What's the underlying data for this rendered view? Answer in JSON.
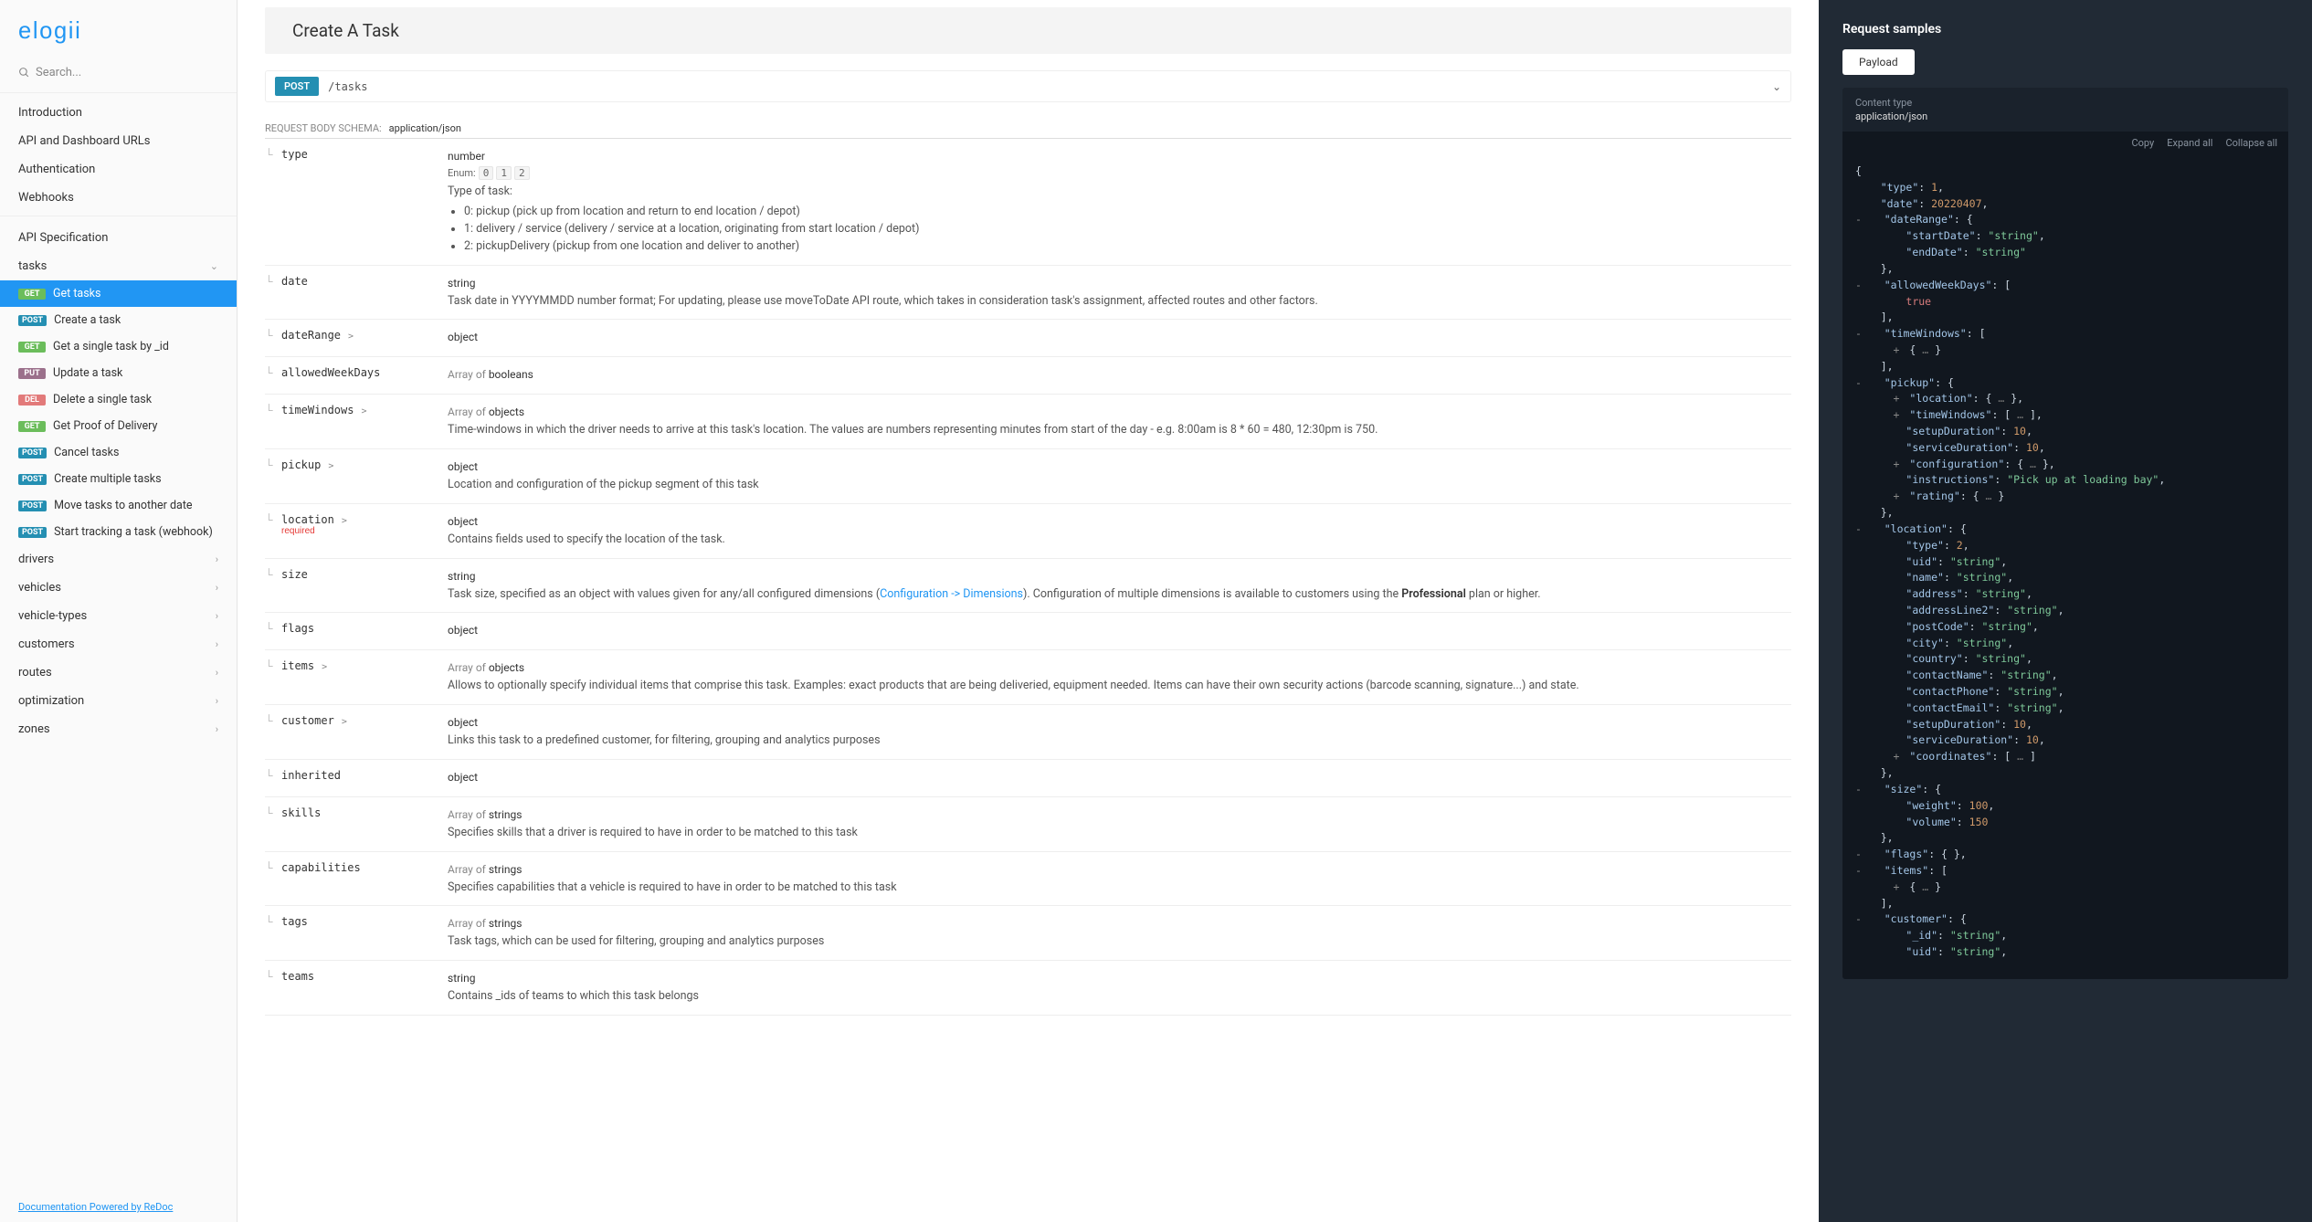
{
  "brand": "elogii",
  "search_placeholder": "Search...",
  "footer": "Documentation Powered by ReDoc",
  "nav_top": [
    "Introduction",
    "API and Dashboard URLs",
    "Authentication",
    "Webhooks"
  ],
  "nav_spec_heading": "API Specification",
  "nav_tasks_label": "tasks",
  "nav_tasks": [
    {
      "method": "GET",
      "label": "Get tasks",
      "active": true
    },
    {
      "method": "POST",
      "label": "Create a task"
    },
    {
      "method": "GET",
      "label": "Get a single task by _id"
    },
    {
      "method": "PUT",
      "label": "Update a task"
    },
    {
      "method": "DEL",
      "label": "Delete a single task"
    },
    {
      "method": "GET",
      "label": "Get Proof of Delivery"
    },
    {
      "method": "POST",
      "label": "Cancel tasks"
    },
    {
      "method": "POST",
      "label": "Create multiple tasks"
    },
    {
      "method": "POST",
      "label": "Move tasks to another date"
    },
    {
      "method": "POST",
      "label": "Start tracking a task (webhook)"
    }
  ],
  "nav_bottom": [
    "drivers",
    "vehicles",
    "vehicle-types",
    "customers",
    "routes",
    "optimization",
    "zones"
  ],
  "page_title": "Create A Task",
  "endpoint": {
    "method": "POST",
    "path": "/tasks"
  },
  "schema_label": "REQUEST BODY SCHEMA:",
  "schema_ct": "application/json",
  "params": [
    {
      "name": "type",
      "type": "number",
      "enum": [
        "0",
        "1",
        "2"
      ],
      "desc_head": "Type of task:",
      "list": [
        "0: pickup (pick up from location and return to end location / depot)",
        "1: delivery / service (delivery / service at a location, originating from start location / depot)",
        "2: pickupDelivery (pickup from one location and deliver to another)"
      ]
    },
    {
      "name": "date",
      "type": "string",
      "desc": "Task date in YYYYMMDD number format; For updating, please use moveToDate API route, which takes in consideration task's assignment, affected routes and other factors."
    },
    {
      "name": "dateRange",
      "expandable": true,
      "type": "object"
    },
    {
      "name": "allowedWeekDays",
      "type_pre": "Array of ",
      "type": "booleans"
    },
    {
      "name": "timeWindows",
      "expandable": true,
      "type_pre": "Array of ",
      "type": "objects",
      "desc": "Time-windows in which the driver needs to arrive at this task's location. The values are numbers representing minutes from start of the day - e.g. 8:00am is 8 * 60 = 480, 12:30pm is 750."
    },
    {
      "name": "pickup",
      "expandable": true,
      "type": "object",
      "desc": "Location and configuration of the pickup segment of this task"
    },
    {
      "name": "location",
      "expandable": true,
      "required": true,
      "type": "object",
      "desc": "Contains fields used to specify the location of the task."
    },
    {
      "name": "size",
      "type": "string",
      "desc_html": "Task size, specified as an object with values given for any/all configured dimensions (<a href='#'>Configuration -> Dimensions</a>). Configuration of multiple dimensions is available to customers using the <strong>Professional</strong> plan or higher."
    },
    {
      "name": "flags",
      "type": "object"
    },
    {
      "name": "items",
      "expandable": true,
      "type_pre": "Array of ",
      "type": "objects",
      "desc": "Allows to optionally specify individual items that comprise this task. Examples: exact products that are being deliveried, equipment needed. Items can have their own security actions (barcode scanning, signature...) and state."
    },
    {
      "name": "customer",
      "expandable": true,
      "type": "object",
      "desc": "Links this task to a predefined customer, for filtering, grouping and analytics purposes"
    },
    {
      "name": "inherited",
      "type": "object"
    },
    {
      "name": "skills",
      "type_pre": "Array of ",
      "type": "strings",
      "desc": "Specifies skills that a driver is required to have in order to be matched to this task"
    },
    {
      "name": "capabilities",
      "type_pre": "Array of ",
      "type": "strings",
      "desc": "Specifies capabilities that a vehicle is required to have in order to be matched to this task"
    },
    {
      "name": "tags",
      "type_pre": "Array of ",
      "type": "strings",
      "desc": "Task tags, which can be used for filtering, grouping and analytics purposes"
    },
    {
      "name": "teams",
      "type": "string",
      "desc": "Contains _ids of teams to which this task belongs"
    }
  ],
  "samples_title": "Request samples",
  "samples_tab": "Payload",
  "ct_label": "Content type",
  "ct_value": "application/json",
  "tools": {
    "copy": "Copy",
    "expand": "Expand all",
    "collapse": "Collapse all"
  },
  "json_sample": {
    "type": 1,
    "date": 20220407,
    "dateRange": {
      "startDate": "string",
      "endDate": "string"
    },
    "allowedWeekDays": [
      true
    ],
    "timeWindows_collapsed": true,
    "pickup": {
      "location_collapsed": true,
      "timeWindows_collapsed": true,
      "setupDuration": 10,
      "serviceDuration": 10,
      "configuration_collapsed": true,
      "instructions": "Pick up at loading bay",
      "rating_collapsed": true
    },
    "location": {
      "type": 2,
      "uid": "string",
      "name": "string",
      "address": "string",
      "addressLine2": "string",
      "postCode": "string",
      "city": "string",
      "country": "string",
      "contactName": "string",
      "contactPhone": "string",
      "contactEmail": "string",
      "setupDuration": 10,
      "serviceDuration": 10,
      "coordinates_collapsed": true
    },
    "size": {
      "weight": 100,
      "volume": 150
    },
    "flags_collapsed": true,
    "items_collapsed": true,
    "customer": {
      "_id": "string",
      "uid": "string"
    }
  }
}
